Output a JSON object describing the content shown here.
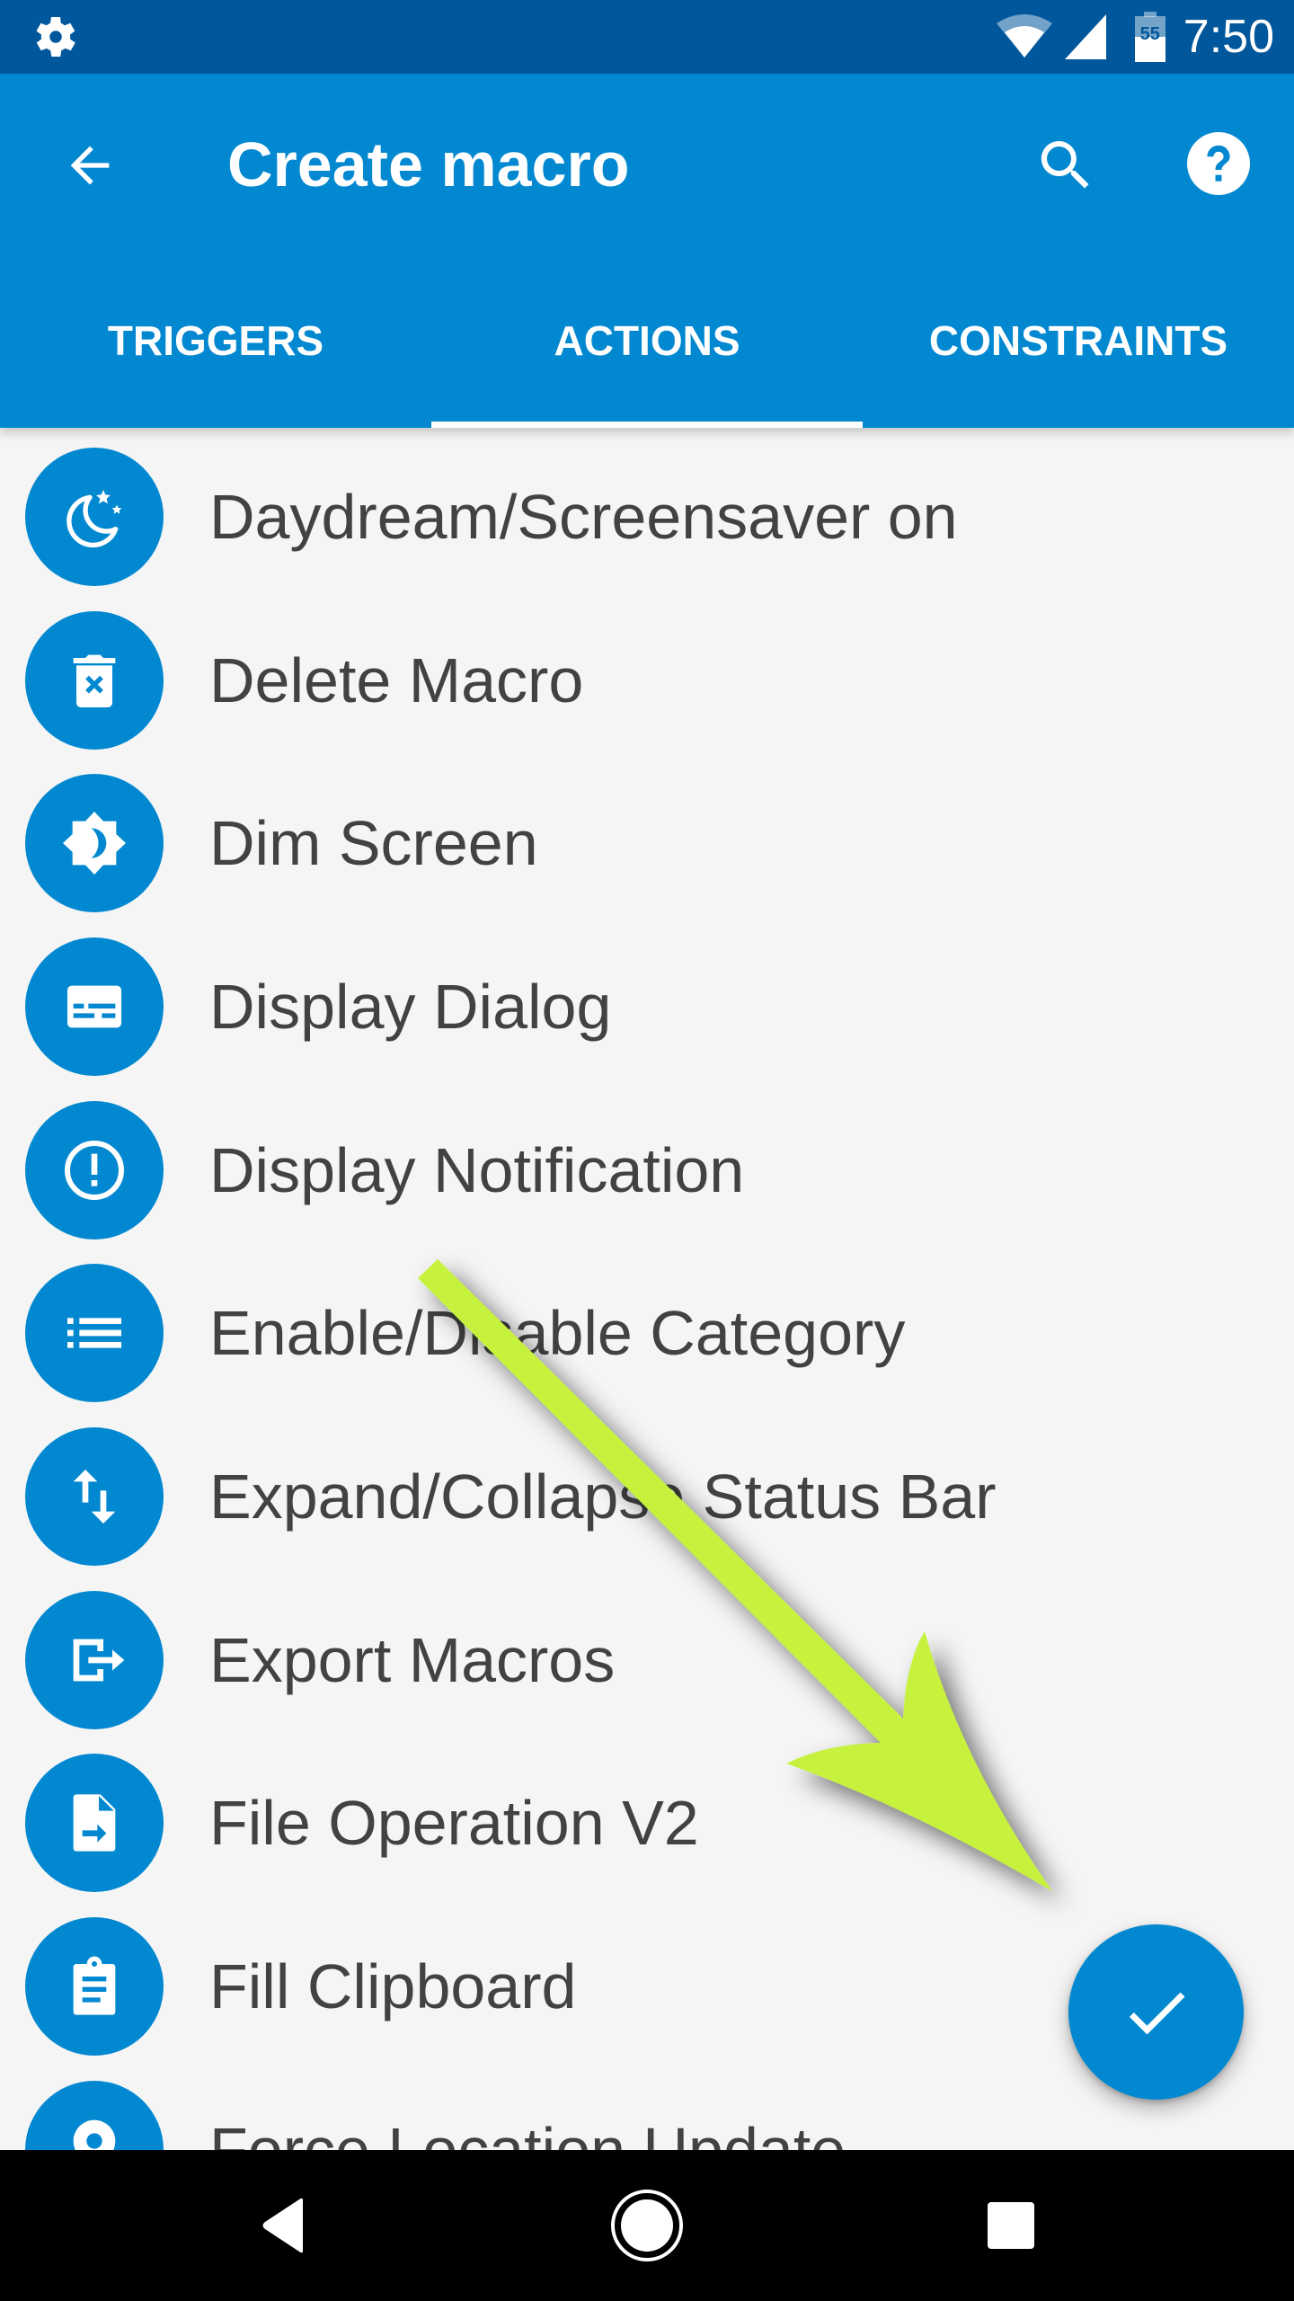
{
  "status_bar": {
    "left_icon": "gear-icon",
    "icons": [
      "wifi-icon",
      "cellular-signal-icon",
      "battery-icon"
    ],
    "battery_level": "55",
    "time": "7:50"
  },
  "toolbar": {
    "back_icon": "arrow-back-icon",
    "title": "Create macro",
    "search_icon": "search-icon",
    "help_icon": "help-circle-icon"
  },
  "tabs": [
    {
      "label": "TRIGGERS",
      "active": false
    },
    {
      "label": "ACTIONS",
      "active": true
    },
    {
      "label": "CONSTRAINTS",
      "active": false
    }
  ],
  "actions": [
    {
      "label": "Daydream/Screensaver on",
      "icon": "moon-stars-icon"
    },
    {
      "label": "Delete Macro",
      "icon": "delete-forever-icon"
    },
    {
      "label": "Dim Screen",
      "icon": "brightness-dim-icon"
    },
    {
      "label": "Display Dialog",
      "icon": "dialog-box-icon"
    },
    {
      "label": "Display Notification",
      "icon": "alert-circle-icon"
    },
    {
      "label": "Enable/Disable Category",
      "icon": "list-icon"
    },
    {
      "label": "Expand/Collapse Status Bar",
      "icon": "swap-vertical-icon"
    },
    {
      "label": "Export Macros",
      "icon": "export-icon"
    },
    {
      "label": "File Operation V2",
      "icon": "file-move-icon"
    },
    {
      "label": "Fill Clipboard",
      "icon": "clipboard-text-icon"
    },
    {
      "label": "Force Location Update",
      "icon": "location-pin-icon"
    }
  ],
  "fab": {
    "icon": "check-icon",
    "label": "Done"
  },
  "nav_bar": {
    "back": "nav-back-icon",
    "home": "nav-home-icon",
    "recents": "nav-recents-icon"
  },
  "annotation": {
    "type": "arrow",
    "color": "#c6f23e",
    "points_to": "fab"
  },
  "colors": {
    "status_bar": "#01579b",
    "primary": "#0288d1",
    "background": "#f5f5f5",
    "text": "#424242",
    "on_primary": "#ffffff"
  }
}
